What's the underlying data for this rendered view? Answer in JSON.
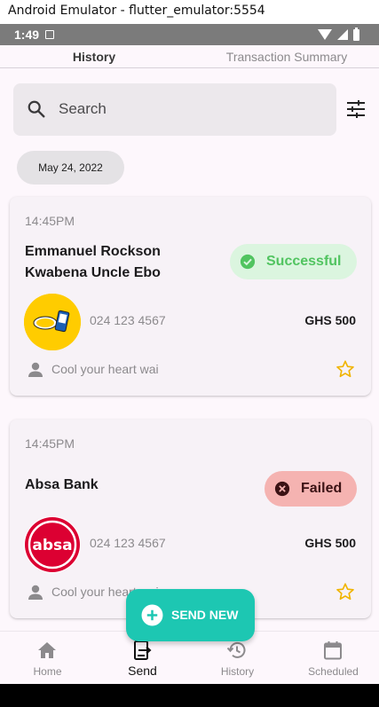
{
  "window": {
    "title": "Android Emulator - flutter_emulator:5554"
  },
  "status_bar": {
    "time": "1:49"
  },
  "tabs": [
    {
      "label": "History",
      "active": true
    },
    {
      "label": "Transaction Summary",
      "active": false
    }
  ],
  "search": {
    "placeholder": "Search"
  },
  "date_chip": "May 24, 2022",
  "transactions": [
    {
      "time": "14:45PM",
      "name": "Emmanuel Rockson Kwabena Uncle Ebo",
      "status": "Successful",
      "status_color": "#51c460",
      "account": "024 123 4567",
      "amount": "GHS 500",
      "note": "Cool your heart wai",
      "logo": "mtn-momo-logo"
    },
    {
      "time": "14:45PM",
      "name": "Absa Bank",
      "status": "Failed",
      "status_color": "#3b1214",
      "account": "024 123 4567",
      "amount": "GHS 500",
      "note": "Cool your heart wai",
      "logo": "absa-logo"
    }
  ],
  "fab": {
    "label": "SEND NEW",
    "color": "#1dc7b2"
  },
  "bottom_nav": [
    {
      "label": "Home",
      "icon": "home-icon"
    },
    {
      "label": "Send",
      "icon": "send-icon",
      "active": true
    },
    {
      "label": "History",
      "icon": "history-icon"
    },
    {
      "label": "Scheduled",
      "icon": "calendar-icon"
    }
  ],
  "colors": {
    "accent": "#1dc7b2",
    "star": "#f0b400",
    "success_bg": "#dbf5df",
    "failed_bg": "#f5b3b1"
  }
}
